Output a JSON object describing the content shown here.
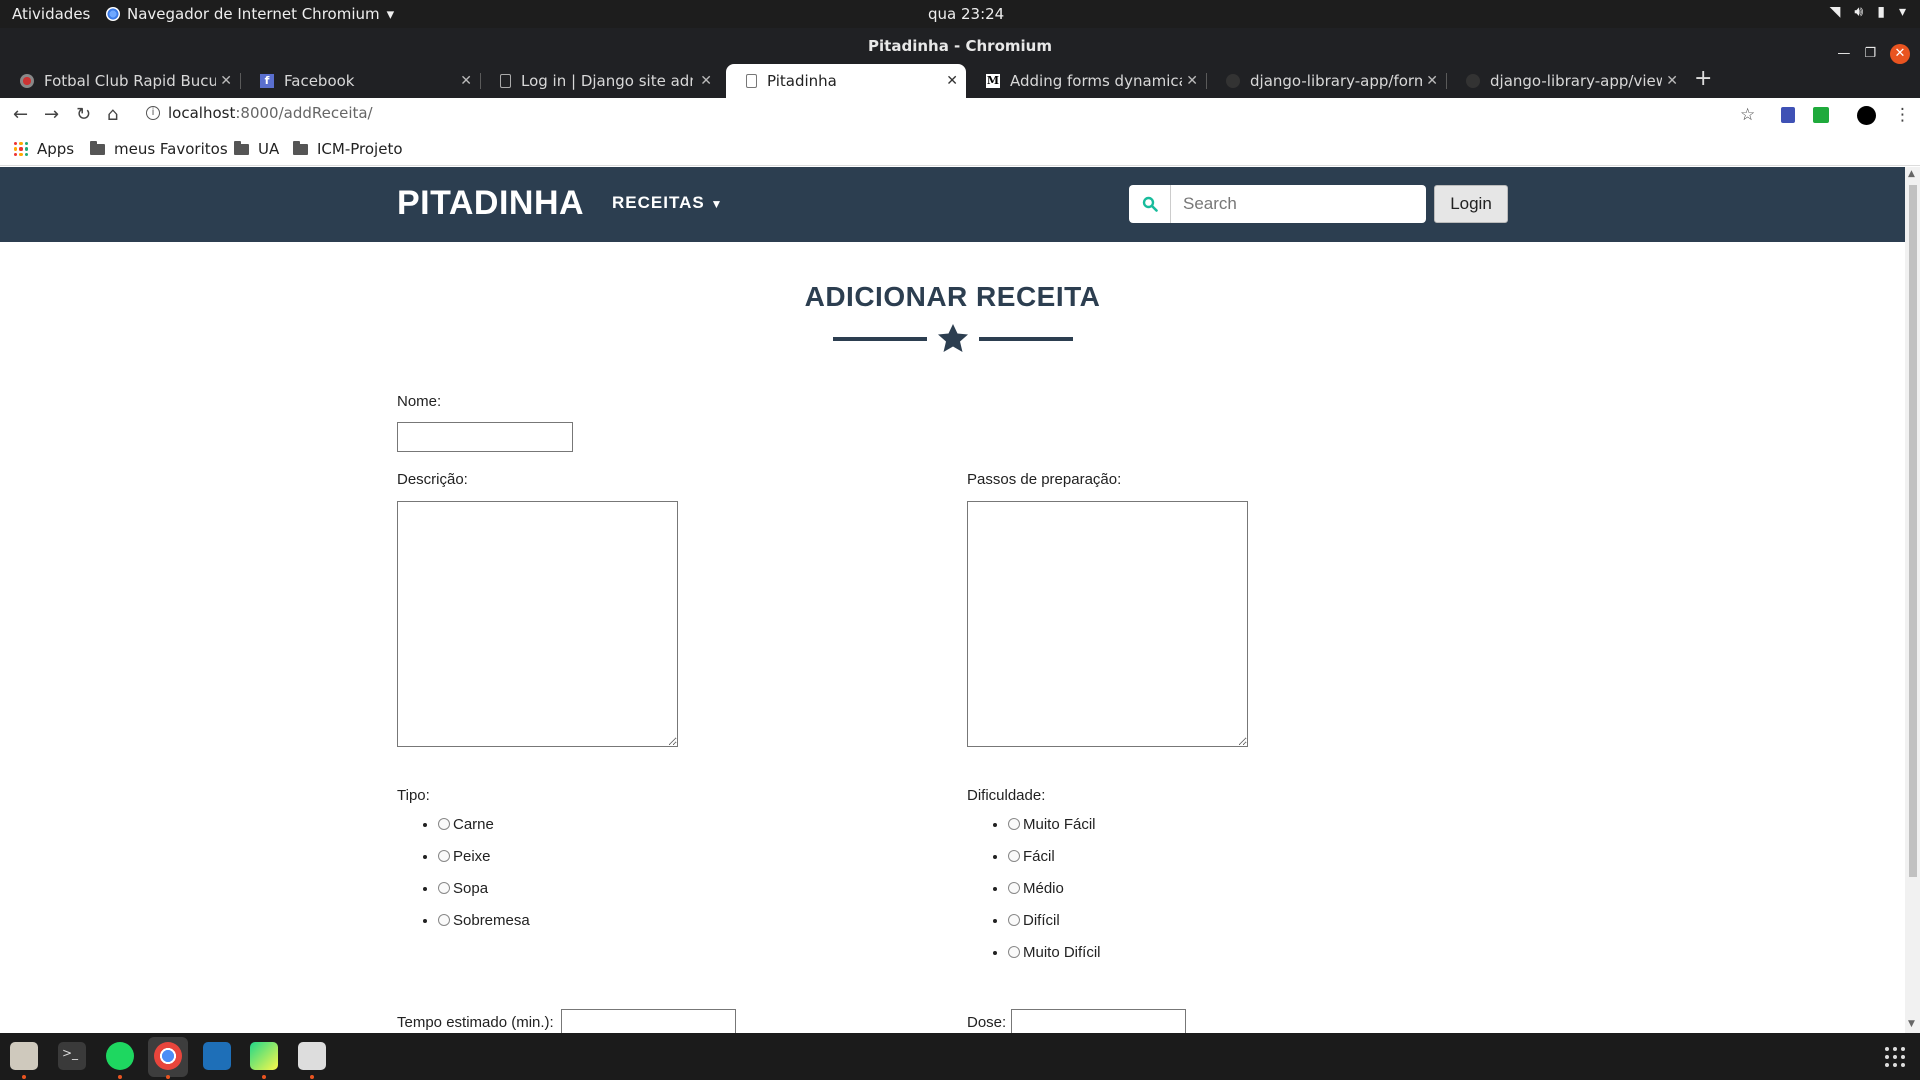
{
  "system": {
    "activities": "Atividades",
    "app_name": "Navegador de Internet Chromium",
    "clock": "qua 23:24"
  },
  "window": {
    "title": "Pitadinha - Chromium"
  },
  "tabs": [
    {
      "label": "Fotbal Club Rapid Bucure",
      "icon": "rapid-favicon-icon"
    },
    {
      "label": "Facebook",
      "icon": "facebook-icon"
    },
    {
      "label": "Log in | Django site admin",
      "icon": "page-icon"
    },
    {
      "label": "Pitadinha",
      "icon": "page-icon",
      "active": true
    },
    {
      "label": "Adding forms dynamically",
      "icon": "medium-icon"
    },
    {
      "label": "django-library-app/forms",
      "icon": "github-icon"
    },
    {
      "label": "django-library-app/views",
      "icon": "github-icon"
    }
  ],
  "address": {
    "host": "localhost",
    "path": ":8000/addReceita/"
  },
  "bookmarks": [
    {
      "label": "Apps"
    },
    {
      "label": "meus Favoritos"
    },
    {
      "label": "UA"
    },
    {
      "label": "ICM-Projeto"
    }
  ],
  "site": {
    "brand": "PITADINHA",
    "menu_receitas": "RECEITAS",
    "search_placeholder": "Search",
    "login_label": "Login",
    "colors": {
      "navbar": "#2c3e50",
      "accent": "#18bc9c"
    }
  },
  "form": {
    "heading": "ADICIONAR RECEITA",
    "nome_label": "Nome:",
    "descricao_label": "Descrição:",
    "passos_label": "Passos de preparação:",
    "tipo_label": "Tipo:",
    "tipo_options": [
      "Carne",
      "Peixe",
      "Sopa",
      "Sobremesa"
    ],
    "dificuldade_label": "Dificuldade:",
    "dificuldade_options": [
      "Muito Fácil",
      "Fácil",
      "Médio",
      "Difícil",
      "Muito Difícil"
    ],
    "tempo_label": "Tempo estimado (min.):",
    "dose_label": "Dose:"
  }
}
